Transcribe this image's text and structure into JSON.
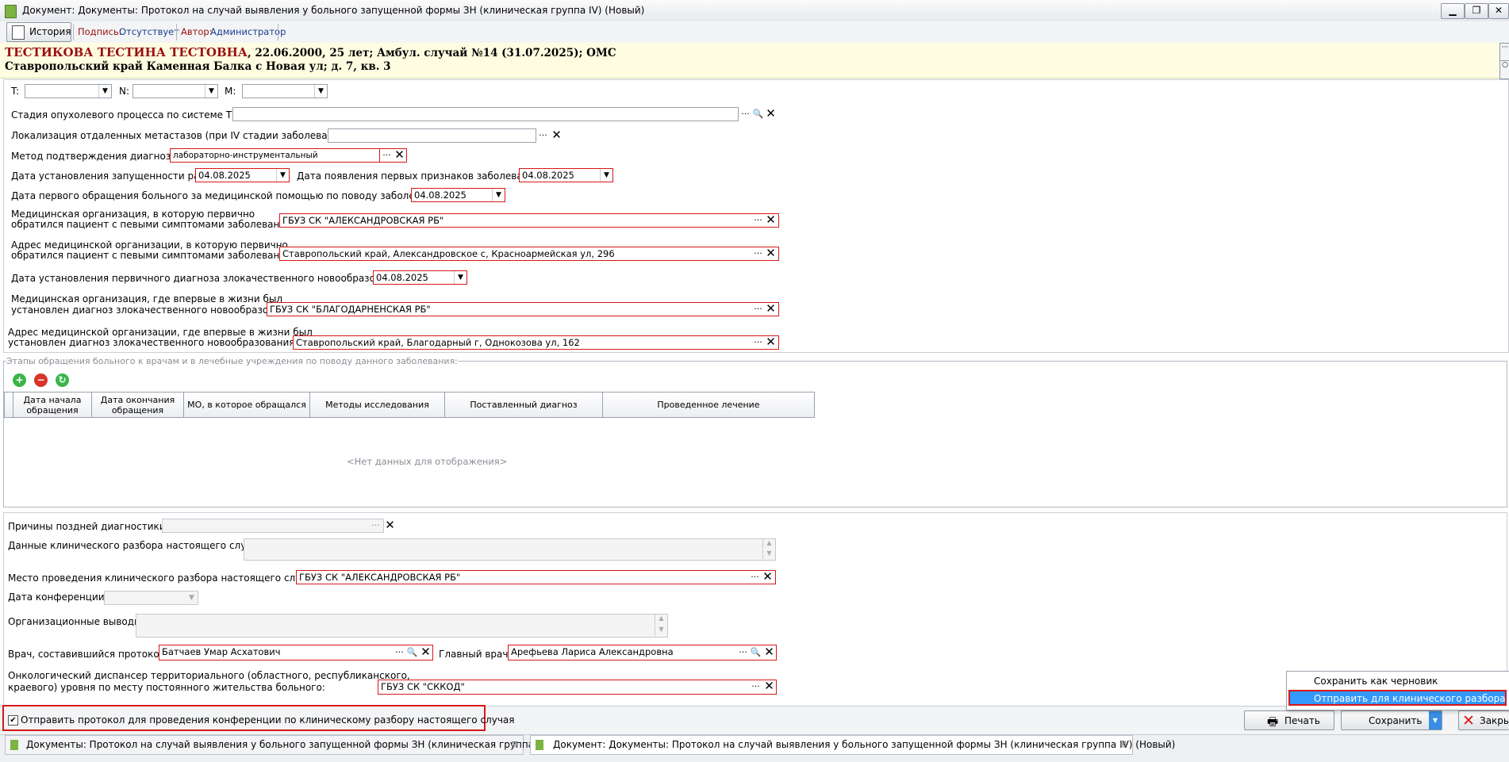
{
  "window": {
    "title": "Документ: Документы: Протокол на случай выявления у больного запущенной формы ЗН (клиническая группа IV) (Новый)",
    "buttons": {
      "minimize": "▁",
      "restore": "❐",
      "close": "✕"
    }
  },
  "toolbar": {
    "history_label": "История",
    "signature_label": "Подпись:",
    "signature_value": "Отсутствует",
    "author_label": "Автор:",
    "author_value": "Администратор"
  },
  "patient": {
    "name": "ТЕСТИКОВА ТЕСТИНА ТЕСТОВНА",
    "details": ", 22.06.2000, 25 лет; Амбул. случай №14 (31.07.2025); ОМС",
    "address": "Ставропольский край Каменная Балка с Новая ул; д. 7, кв. 3"
  },
  "tnm": {
    "t_label": "T:",
    "n_label": "N:",
    "m_label": "M:",
    "t_value": "",
    "n_value": "",
    "m_value": ""
  },
  "form": {
    "stage_label": "Стадия опухолевого процесса по системе TNM:",
    "stage_value": "",
    "metastasis_label": "Локализация отдаленных метастазов (при IV стадии заболевания):",
    "metastasis_value": "",
    "method_label": "Метод подтверждения диагноза:",
    "method_value": "лабораторно-инструментальный",
    "neglect_date_label": "Дата установления запущенности рака:",
    "neglect_date_value": "04.08.2025",
    "first_signs_label": "Дата появления первых признаков заболевания:",
    "first_signs_value": "04.08.2025",
    "first_visit_label": "Дата первого обращения больного за медицинской помощью по поводу заболевания:",
    "first_visit_value": "04.08.2025",
    "first_org_label_1": "Медицинская организация, в которую первично",
    "first_org_label_2": "обратился пациент с певыми симптомами заболевания:",
    "first_org_value": "ГБУЗ СК \"АЛЕКСАНДРОВСКАЯ РБ\"",
    "first_addr_label_1": "Адрес медицинской организации, в которую первично",
    "first_addr_label_2": "обратился пациент с певыми симптомами заболевания:",
    "first_addr_value": "Ставропольский край, Александровское с, Красноармейская ул, 296",
    "primary_diag_date_label": "Дата установления первичного диагноза злокачественного новообразования:",
    "primary_diag_date_value": "04.08.2025",
    "diag_org_label_1": "Медицинская организация, где впервые в жизни был",
    "diag_org_label_2": "установлен диагноз злокачественного новообразования:",
    "diag_org_value": "ГБУЗ СК \"БЛАГОДАРНЕНСКАЯ РБ\"",
    "diag_addr_label_1": "Адрес медицинской организации, где впервые в жизни был",
    "diag_addr_label_2": "установлен диагноз злокачественного новообразования:",
    "diag_addr_value": "Ставропольский край, Благодарный г, Однокозова ул, 162"
  },
  "stages": {
    "legend": "Этапы обращения больного к врачам и в лечебные учреждения по поводу данного заболевания:",
    "columns": [
      "Дата начала обращения",
      "Дата окончания обращения",
      "МО, в которое обращался",
      "Методы исследования",
      "Поставленный диагноз",
      "Проведенное лечение"
    ],
    "empty_text": "<Нет данных для отображения>"
  },
  "lower": {
    "late_reasons_label": "Причины поздней диагностики:",
    "late_reasons_value": "",
    "clinical_data_label": "Данные клинического разбора настоящего случая:",
    "clinical_data_value": "",
    "review_place_label": "Место проведения клинического разбора настоящего случая:",
    "review_place_value": "ГБУЗ СК \"АЛЕКСАНДРОВСКАЯ РБ\"",
    "conf_date_label": "Дата конференции:",
    "conf_date_value": "",
    "conclusions_label": "Организационные выводы:",
    "conclusions_value": "",
    "doctor_label": "Врач, составившийся протокол:",
    "doctor_value": "Батчаев Умар Асхатович",
    "chief_label": "Главный врач:",
    "chief_value": "Арефьева Лариса Александровна",
    "dispensary_label_1": "Онкологический диспансер территориального (областного, республиканского,",
    "dispensary_label_2": "краевого) уровня по месту постоянного жительства больного:",
    "dispensary_value": "ГБУЗ СК \"СККОД\""
  },
  "bottom": {
    "send_checkbox_label": "Отправить протокол для проведения конференции по клиническому разбору настоящего случая",
    "send_checked": true,
    "print_label": "Печать",
    "save_label": "Сохранить",
    "close_label": "Закрыть"
  },
  "save_menu": {
    "items": [
      "Сохранить как черновик",
      "Отправить для клинического разбора"
    ]
  },
  "tabs": [
    "Документы: Протокол на случай выявления у больного запущенной формы ЗН (клиническая группа IV)",
    "Документ: Документы: Протокол на случай выявления у больного запущенной формы ЗН (клиническая группа IV) (Новый)"
  ],
  "colors": {
    "required_border": "#d81818",
    "patient_bg": "#fffde1",
    "patient_name": "#9a0f0f",
    "menu_highlight": "#3399ff"
  }
}
